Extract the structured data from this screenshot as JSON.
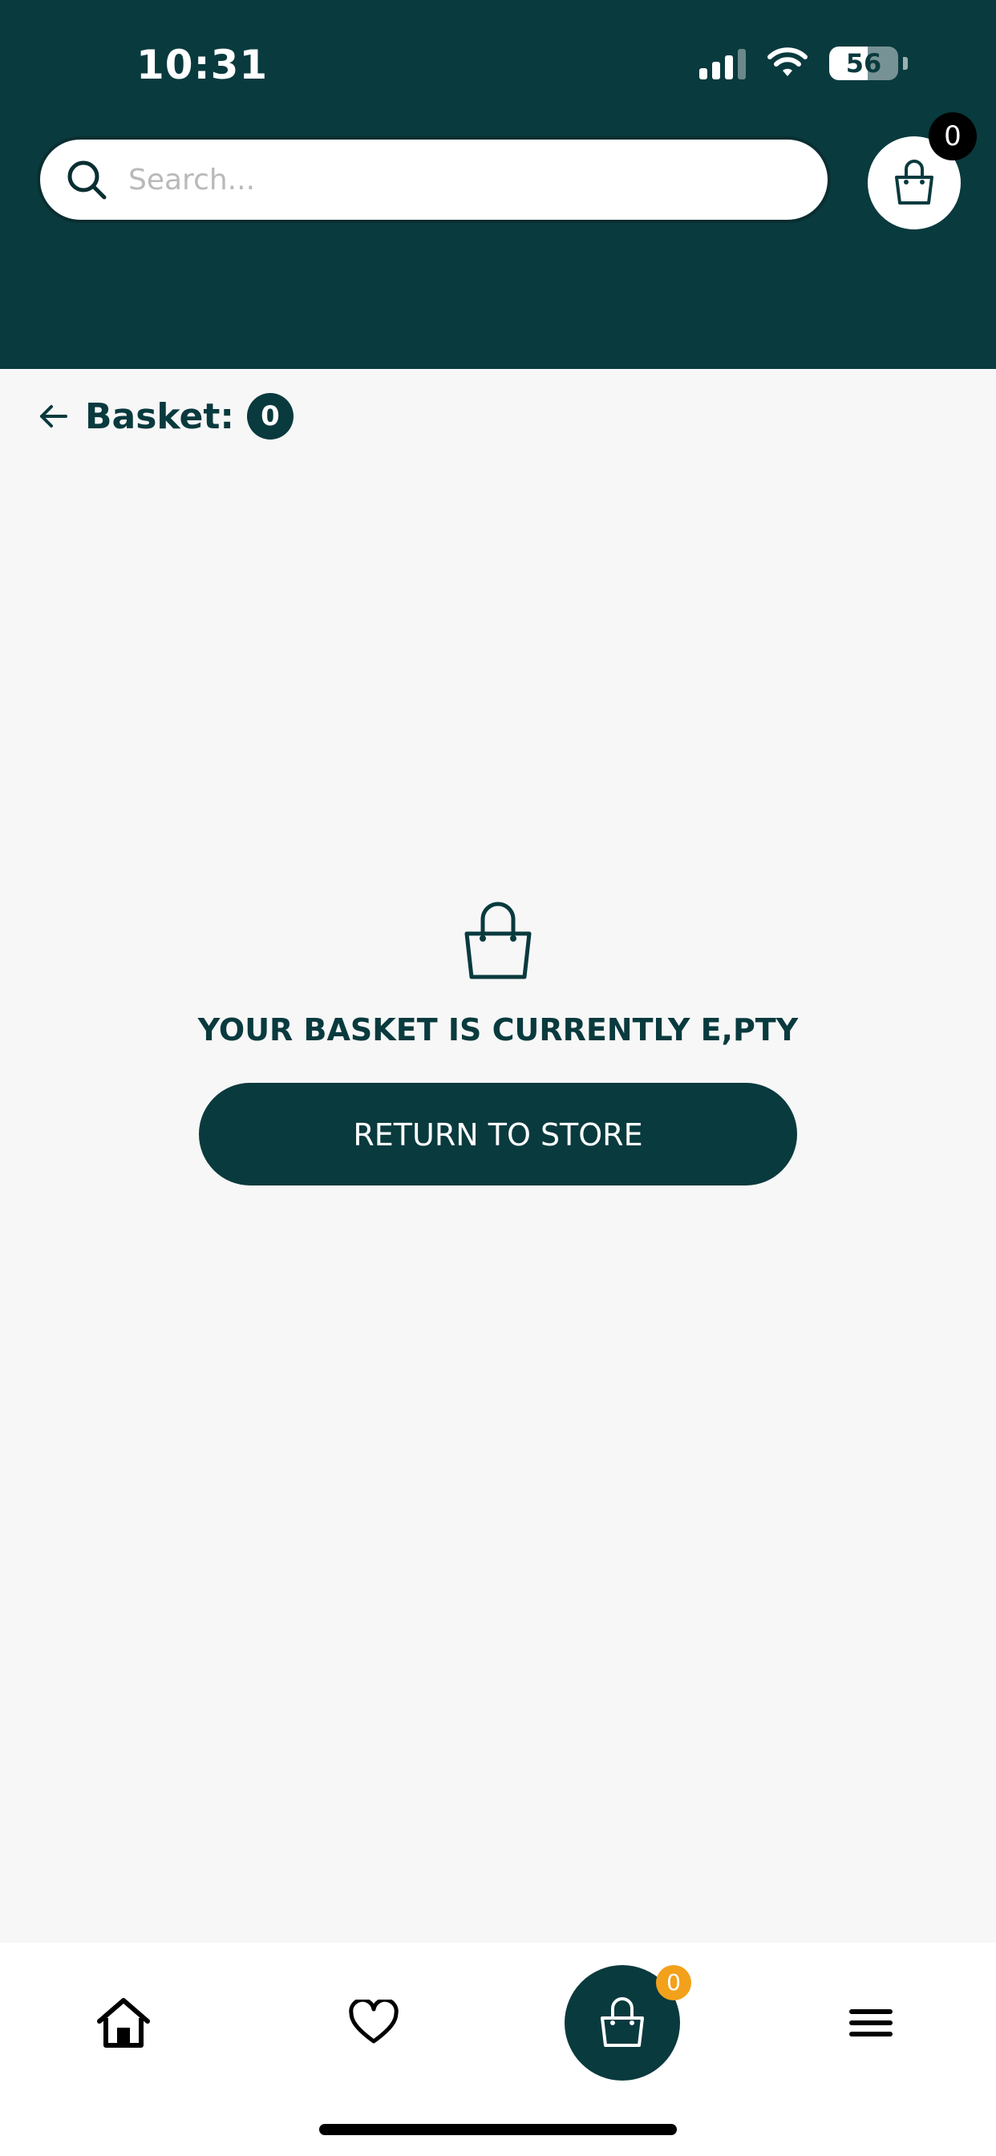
{
  "status_bar": {
    "time": "10:31",
    "battery": "56",
    "battery_level": 0.56,
    "signal_bars_active": 3,
    "signal_bars_total": 4
  },
  "header": {
    "search": {
      "placeholder": "Search...",
      "value": ""
    },
    "cart_count": "0"
  },
  "basket": {
    "back_icon": "arrow-left-icon",
    "title": "Basket:",
    "count": "0",
    "empty_icon": "shopping-bag-icon",
    "empty_message": "YOUR BASKET IS CURRENTLY E,PTY",
    "return_button_label": "RETURN TO STORE"
  },
  "bottom_nav": {
    "items": [
      {
        "icon": "home-icon"
      },
      {
        "icon": "heart-icon"
      },
      {
        "icon": "shopping-bag-icon",
        "badge": "0"
      },
      {
        "icon": "menu-icon"
      }
    ]
  },
  "colors": {
    "brand": "#093a3e",
    "background": "#f7f7f7",
    "badge_orange": "#f3a11b"
  }
}
